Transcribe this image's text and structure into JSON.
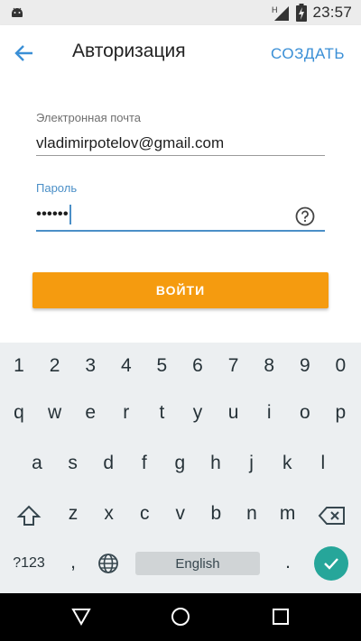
{
  "status_bar": {
    "time": "23:57",
    "network_label": "H",
    "icons": [
      "android-icon",
      "signal-icon",
      "battery-charging-icon"
    ]
  },
  "app_bar": {
    "back_icon": "arrow-left-icon",
    "title": "Авторизация",
    "action_label": "СОЗДАТЬ"
  },
  "form": {
    "email": {
      "label": "Электронная почта",
      "value": "vladimirpotelov@gmail.com"
    },
    "password": {
      "label": "Пароль",
      "value": "••••••",
      "help_icon": "question-circle-icon"
    },
    "submit_label": "ВОЙТИ"
  },
  "keyboard": {
    "rows": [
      [
        "1",
        "2",
        "3",
        "4",
        "5",
        "6",
        "7",
        "8",
        "9",
        "0"
      ],
      [
        "q",
        "w",
        "e",
        "r",
        "t",
        "y",
        "u",
        "i",
        "o",
        "p"
      ],
      [
        "a",
        "s",
        "d",
        "f",
        "g",
        "h",
        "j",
        "k",
        "l"
      ],
      [
        "z",
        "x",
        "c",
        "v",
        "b",
        "n",
        "m"
      ]
    ],
    "symbols_label": "?123",
    "comma_label": ",",
    "period_label": ".",
    "space_label": "English",
    "icons": [
      "shift-icon",
      "backspace-icon",
      "globe-icon",
      "enter-check-icon"
    ]
  },
  "nav_bar": {
    "icons": [
      "back-triangle-icon",
      "home-circle-icon",
      "recents-square-icon"
    ]
  },
  "colors": {
    "accent": "#3a8fd6",
    "focus": "#4a8fc7",
    "button": "#f59b0f",
    "enter_key": "#26a69a",
    "keyboard_bg": "#eceff1"
  }
}
